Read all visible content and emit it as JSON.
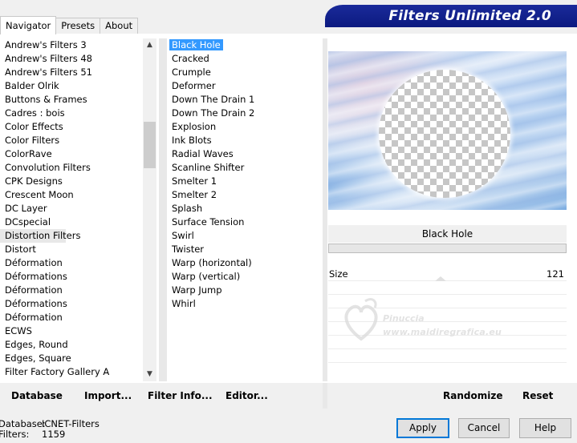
{
  "tabs": [
    "Navigator",
    "Presets",
    "About"
  ],
  "banner_title": "Filters Unlimited 2.0",
  "categories": [
    "Andrew's Filters 3",
    "Andrew's Filters 48",
    "Andrew's Filters 51",
    "Balder Olrik",
    "Buttons & Frames",
    "Cadres : bois",
    "Color Effects",
    "Color Filters",
    "ColorRave",
    "Convolution Filters",
    "CPK Designs",
    "Crescent Moon",
    "DC Layer",
    "DCspecial",
    "Distortion Filters",
    "Distort",
    "Déformation",
    "Déformations",
    "Déformation",
    "Déformations",
    "Déformation",
    "ECWS",
    "Edges, Round",
    "Edges, Square",
    "Filter Factory Gallery A"
  ],
  "selected_category": "Distortion Filters",
  "filters": [
    "Black Hole",
    "Cracked",
    "Crumple",
    "Deformer",
    "Down The Drain 1",
    "Down The Drain 2",
    "Explosion",
    "Ink Blots",
    "Radial Waves",
    "Scanline Shifter",
    "Smelter 1",
    "Smelter 2",
    "Splash",
    "Surface Tension",
    "Swirl",
    "Twister",
    "Warp (horizontal)",
    "Warp (vertical)",
    "Warp Jump",
    "Whirl"
  ],
  "selected_filter": "Black Hole",
  "preview": {
    "filter_name": "Black Hole"
  },
  "params": [
    {
      "label": "Size",
      "value": "121",
      "fraction": 0.47
    }
  ],
  "watermark": {
    "name": "Pinuccia",
    "url": "www.maidiregrafica.eu"
  },
  "toolbar": {
    "database": "Database",
    "import": "Import...",
    "filter_info": "Filter Info...",
    "editor": "Editor...",
    "randomize": "Randomize",
    "reset": "Reset"
  },
  "status": {
    "database_label": "Database:",
    "database_value": "ICNET-Filters",
    "filters_label": "Filters:",
    "filters_value": "1159"
  },
  "buttons": {
    "apply": "Apply",
    "cancel": "Cancel",
    "help": "Help"
  },
  "colors": {
    "banner": "#0c1a80",
    "selection": "#3399ff"
  }
}
